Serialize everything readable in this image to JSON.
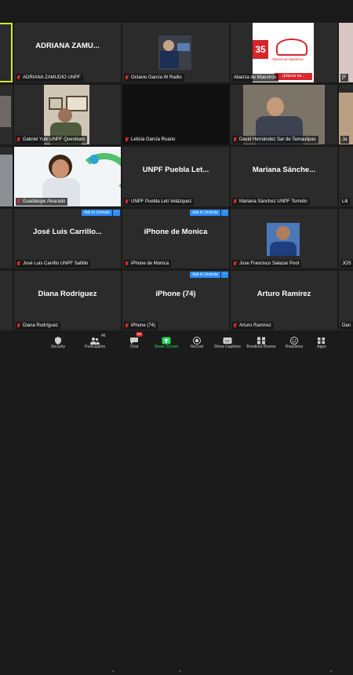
{
  "tiles": [
    {
      "label": "ADRIANA ZAMUDIO UNPF",
      "big": "ADRIANA ZAMU..."
    },
    {
      "label": "Octavio García W Radio"
    },
    {
      "label": "Alianza de Maestros",
      "poster_text": "35",
      "poster_caption": "Alianza de Maestros",
      "poster_tag": "¡Educar es..."
    },
    {
      "label": "Gabriel Yubi UNPF Querétaro"
    },
    {
      "label": "Leticia García Ruano"
    },
    {
      "label": "David Hernández Sar de Tamaulipas"
    },
    {
      "label": "Guadalupe Alvarado"
    },
    {
      "label": "UNPF Puebla Leti Velázquez",
      "big": "UNPF Puebla Let..."
    },
    {
      "label": "Mariana Sánchez UNPF Torreón",
      "big": "Mariana Sánche..."
    },
    {
      "label": "José Luis Carrillo UNPF Saltillo",
      "big": "José Luis Carrillo...",
      "unmute": "Ask to Unmute"
    },
    {
      "label": "iPhone de Monica",
      "big": "iPhone de Monica",
      "unmute": "Ask to Unmute"
    },
    {
      "label": "Jose Francisco Salazar Poot"
    },
    {
      "label": "Diana Rodríguez",
      "big": "Diana Rodríguez"
    },
    {
      "label": "iPhone (74)",
      "big": "iPhone (74)",
      "unmute": "Ask to Unmute"
    },
    {
      "label": "Arturo Ramírez",
      "big": "Arturo Ramírez"
    }
  ],
  "edge_labels": [
    "[F",
    "Ja",
    "Lili",
    "JOS",
    "Dan"
  ],
  "more_glyph": "···",
  "toolbar": {
    "security": "Security",
    "participants": "Participants",
    "participants_count": "46",
    "chat": "Chat",
    "chat_badge": "94",
    "share": "Share Screen",
    "record": "Record",
    "captions": "Show Captions",
    "breakout": "Breakout Rooms",
    "reactions": "Reactions",
    "apps": "Apps",
    "caret": "^"
  },
  "colors": {
    "accent": "#2d8cff",
    "muted_mic": "#e02828",
    "share_green": "#23d959",
    "speaker_outline": "#dbe23a"
  }
}
